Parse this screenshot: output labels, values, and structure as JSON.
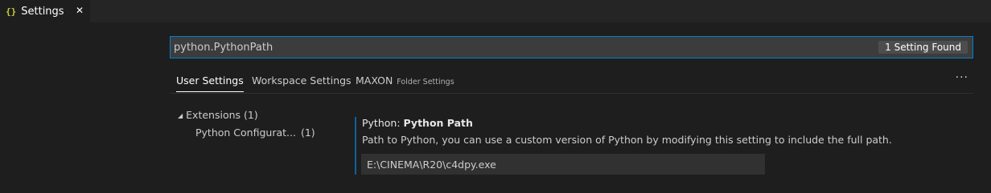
{
  "editor_tab": {
    "icon": "{}",
    "icon_name": "json-braces-icon",
    "label": "Settings",
    "close_glyph": "✕"
  },
  "search": {
    "value": "python.PythonPath",
    "placeholder": "",
    "result_count": "1 Setting Found"
  },
  "scope_tabs": [
    {
      "label": "User Settings",
      "active": true
    },
    {
      "label": "Workspace Settings",
      "active": false
    },
    {
      "label": "MAXON",
      "note": "Folder Settings",
      "active": false
    }
  ],
  "more_actions": "···",
  "toc": {
    "group_label": "Extensions",
    "group_count": "(1)",
    "item_label": "Python Configurat...",
    "item_count": "(1)"
  },
  "setting": {
    "category": "Python:",
    "name": "Python Path",
    "description": "Path to Python, you can use a custom version of Python by modifying this setting to include the full path.",
    "value": "E:\\CINEMA\\R20\\c4dpy.exe"
  },
  "colors": {
    "background": "#1e1e1e",
    "focus_border": "#007fd4",
    "modified_indicator": "#0e639c",
    "json_icon": "#cbcb41"
  }
}
